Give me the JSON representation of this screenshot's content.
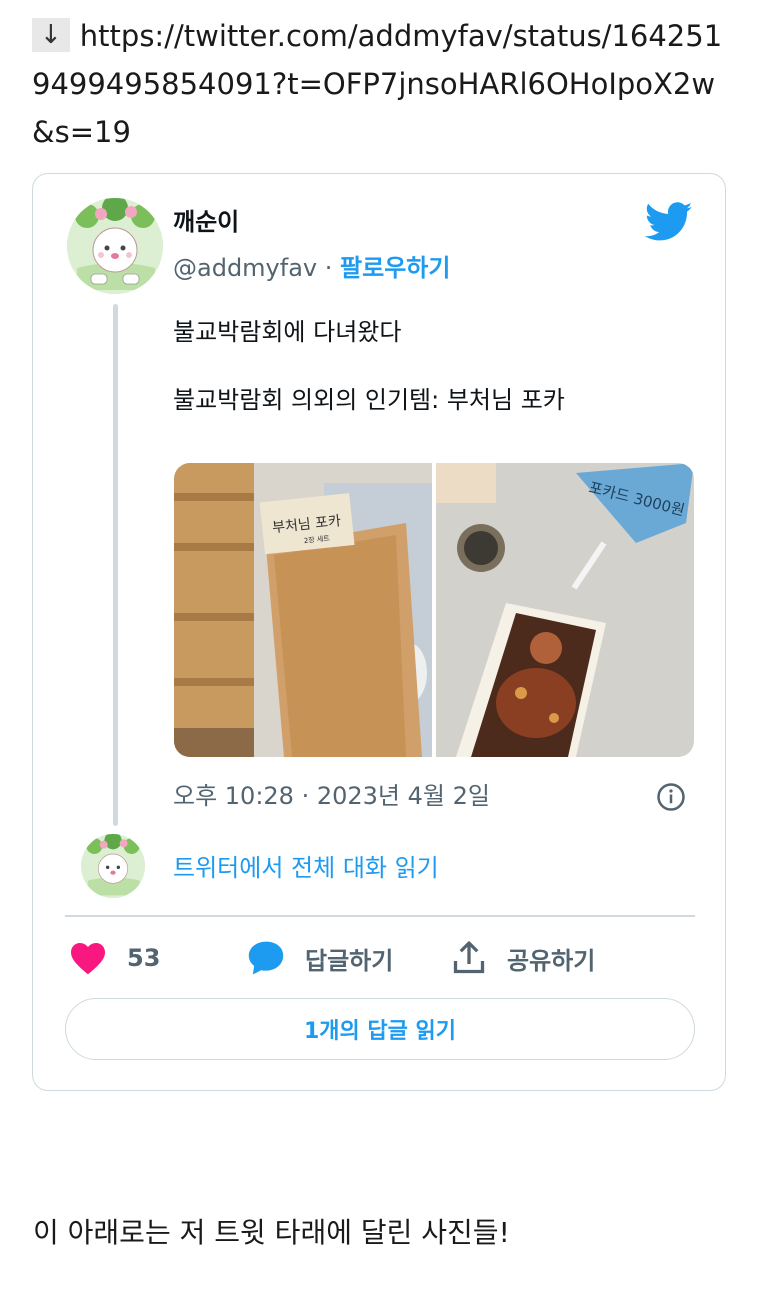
{
  "link": {
    "arrow": "↓",
    "url": "https://twitter.com/addmyfav/status/1642519499495854091?t=OFP7jnsoHARl6OHoIpoX2w&s=19"
  },
  "tweet": {
    "display_name": "깨순이",
    "handle": "@addmyfav",
    "separator": "·",
    "follow_label": "팔로우하기",
    "text_lines": [
      "불교박람회에 다녀왔다",
      "불교박람회 의외의 인기템: 부처님 포카"
    ],
    "timestamp": "오후 10:28 · 2023년 4월 2일",
    "read_conversation": "트위터에서 전체 대화 읽기",
    "like_count": "53",
    "reply_label": "답글하기",
    "share_label": "공유하기",
    "read_replies_label": "1개의 답글 읽기",
    "icons": {
      "brand": "twitter-bird-icon",
      "info": "info-icon",
      "like": "heart-icon",
      "reply": "speech-bubble-icon",
      "share": "share-upload-icon"
    },
    "photos": [
      {
        "handwritten": "부처님 포카",
        "subnote": "2장 세트"
      },
      {
        "handwritten": "포카드 3000원"
      }
    ],
    "colors": {
      "accent": "#1d9bf0",
      "like": "#f91880",
      "muted": "#536471",
      "border": "#cfd9de"
    }
  },
  "footer": {
    "caption": "이 아래로는 저 트윗 타래에 달린 사진들!"
  }
}
